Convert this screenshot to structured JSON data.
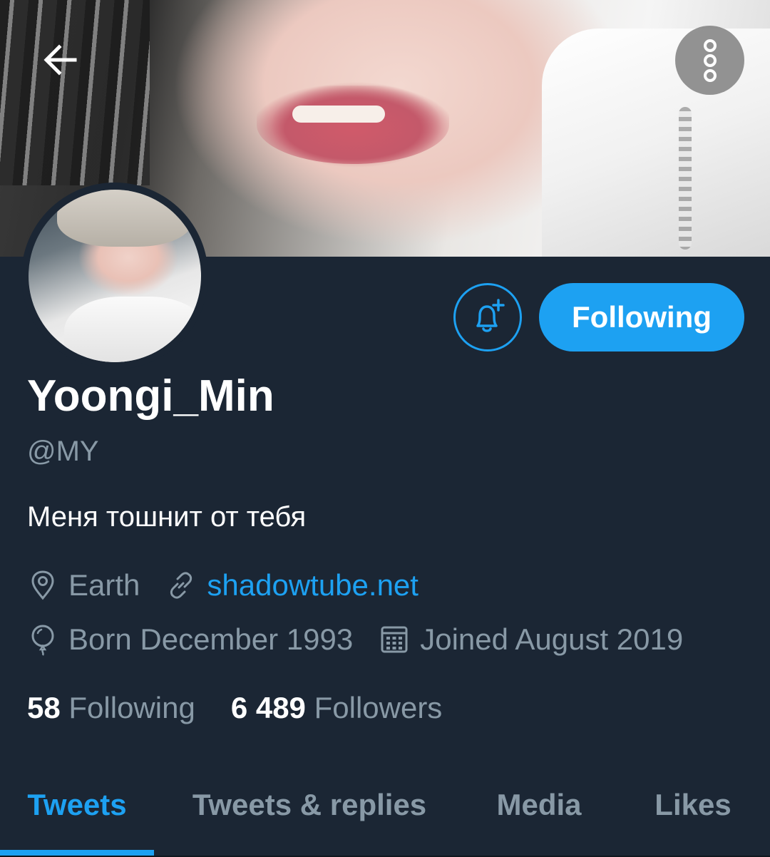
{
  "profile": {
    "display_name": "Yoongi_Min",
    "handle": "@MY",
    "bio": "Меня тошнит от тебя",
    "location": "Earth",
    "website": "shadowtube.net",
    "birthday": "Born December 1993",
    "joined": "Joined August 2019"
  },
  "actions": {
    "following_label": "Following",
    "notify_icon": "bell-plus-icon"
  },
  "stats": {
    "following_count": "58",
    "following_label": "Following",
    "followers_count": "6 489",
    "followers_label": "Followers"
  },
  "tabs": [
    {
      "label": "Tweets",
      "active": true
    },
    {
      "label": "Tweets & replies",
      "active": false
    },
    {
      "label": "Media",
      "active": false
    },
    {
      "label": "Likes",
      "active": false
    }
  ],
  "colors": {
    "background": "#1b2634",
    "accent": "#1da1f2",
    "secondary_text": "#8899a6"
  },
  "icons": {
    "back": "arrow-left-icon",
    "more": "more-vertical-icon",
    "location": "location-pin-icon",
    "link": "link-icon",
    "birthday": "balloon-icon",
    "joined": "calendar-icon"
  }
}
